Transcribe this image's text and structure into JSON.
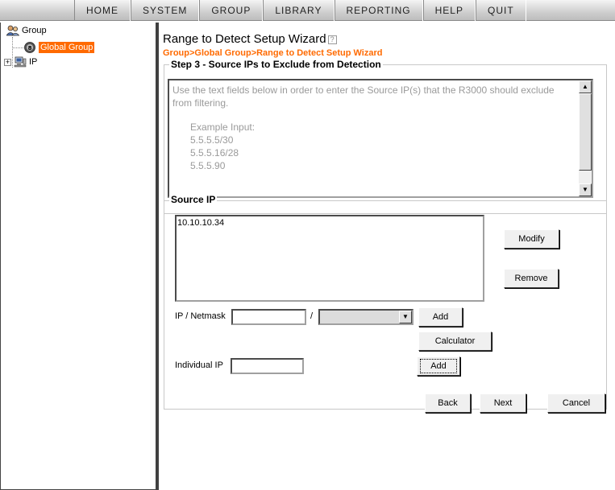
{
  "menu": {
    "items": [
      "HOME",
      "SYSTEM",
      "GROUP",
      "LIBRARY",
      "REPORTING",
      "HELP",
      "QUIT"
    ]
  },
  "tree": {
    "root_label": "Group",
    "selected_label": "Global Group",
    "ip_label": "IP",
    "expander": "+"
  },
  "page": {
    "title": "Range to Detect Setup Wizard",
    "help_icon": "?",
    "breadcrumb": "Group>Global Group>Range to Detect Setup Wizard"
  },
  "step": {
    "legend": "Step 3 - Source IPs to Exclude from Detection",
    "instructions": "Use the text fields below in order to enter the Source IP(s) that the R3000 should exclude from filtering.",
    "example_heading": "Example Input:",
    "examples": [
      "5.5.5.5/30",
      "5.5.5.16/28",
      "5.5.5.90"
    ]
  },
  "source_ip": {
    "legend": "Source IP",
    "list": [
      "10.10.10.34"
    ],
    "modify_label": "Modify",
    "remove_label": "Remove",
    "ip_netmask_label": "IP / Netmask",
    "ip_value": "",
    "slash": "/",
    "netmask_selected": "",
    "add_label": "Add",
    "calculator_label": "Calculator",
    "individual_ip_label": "Individual IP",
    "individual_ip_value": "",
    "add_individual_label": "Add"
  },
  "nav": {
    "back_label": "Back",
    "next_label": "Next",
    "cancel_label": "Cancel"
  },
  "colors": {
    "accent": "#ff6a00"
  }
}
